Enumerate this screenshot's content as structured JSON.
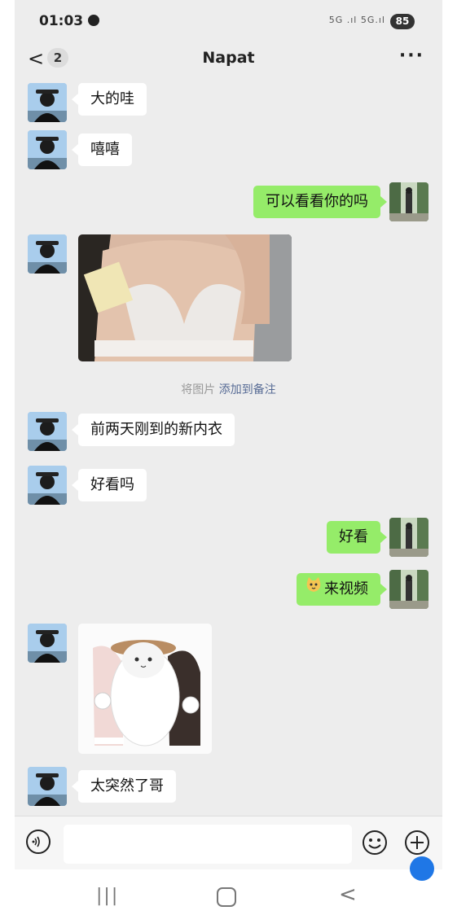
{
  "status_bar": {
    "time": "01:03",
    "network": "5G .ıl 5G.ıl",
    "battery": "85"
  },
  "header": {
    "back_label": "<",
    "unread_count": "2",
    "title": "Napat",
    "more_label": "···"
  },
  "messages": [
    {
      "side": "left",
      "type": "text",
      "text": "大的哇"
    },
    {
      "side": "left",
      "type": "text",
      "text": "嘻嘻"
    },
    {
      "side": "right",
      "type": "text",
      "text": "可以看看你的吗"
    },
    {
      "side": "left",
      "type": "image",
      "content": "photo"
    },
    {
      "side": "left",
      "type": "text",
      "text": "前两天刚到的新内衣"
    },
    {
      "side": "left",
      "type": "text",
      "text": "好看吗"
    },
    {
      "side": "right",
      "type": "text",
      "text": "好看"
    },
    {
      "side": "right",
      "type": "text",
      "text": "来视频",
      "emoji": "cat-face"
    },
    {
      "side": "left",
      "type": "image",
      "content": "cat-meme-sticker"
    },
    {
      "side": "left",
      "type": "text",
      "text": "太突然了哥"
    }
  ],
  "system_note": {
    "prefix": "将图片",
    "link": "添加到备注"
  },
  "input_bar": {
    "text_value": "",
    "icons": [
      "voice-icon",
      "microphone-icon",
      "emoji-icon",
      "plus-icon"
    ]
  },
  "navigation": {
    "recent_label": "|||",
    "back_label": "<"
  },
  "colors": {
    "sent_bubble": "#95ec69",
    "received_bubble": "#ffffff",
    "chat_background": "#ededed",
    "link": "#576b95"
  }
}
